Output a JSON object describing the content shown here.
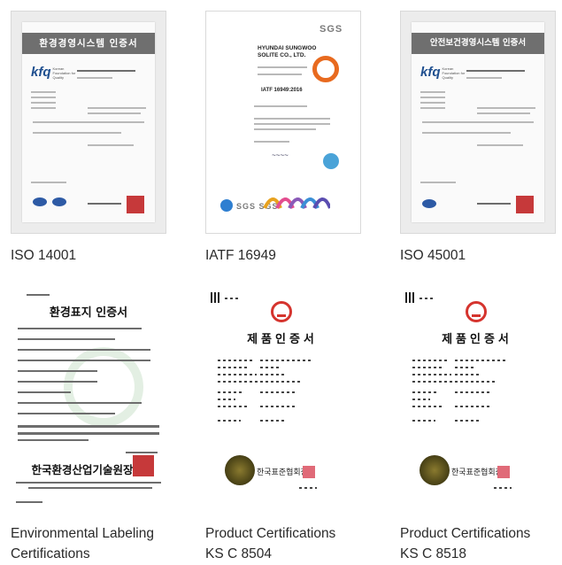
{
  "certificates": [
    {
      "caption": [
        "ISO 14001"
      ],
      "banner": "환경경영시스템 인증서",
      "logo": "kfq"
    },
    {
      "caption": [
        "IATF 16949"
      ],
      "header": "SGS",
      "company": "HYUNDAI SUNGWOO SOLITE CO., LTD.",
      "standard": "IATF 16949:2016"
    },
    {
      "caption": [
        "ISO 45001"
      ],
      "banner": "안전보건경영시스템 인증서",
      "logo": "kfq"
    },
    {
      "caption": [
        "Environmental Labeling",
        "Certifications"
      ],
      "title": "환경표지 인증서",
      "footer": "한국환경산업기술원장"
    },
    {
      "caption": [
        "Product Certifications",
        "KS C 8504"
      ],
      "title": "제품인증서",
      "org": "한국표준협회장"
    },
    {
      "caption": [
        "Product Certifications",
        "KS C 8518"
      ],
      "title": "제품인증서",
      "org": "한국표준협회장"
    }
  ]
}
